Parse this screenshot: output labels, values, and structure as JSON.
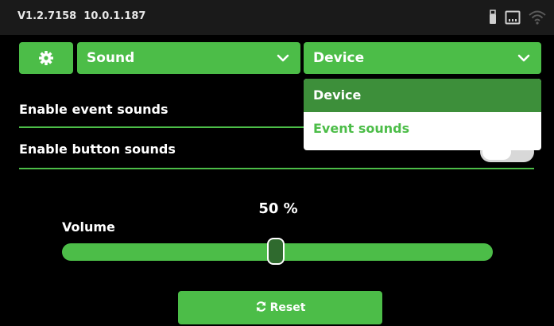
{
  "statusbar": {
    "version": "V1.2.7158",
    "ip": "10.0.1.187",
    "icons": [
      "usb-icon",
      "ethernet-icon",
      "wifi-icon"
    ]
  },
  "header": {
    "settings_icon": "gear-icon",
    "category_dropdown": {
      "selected": "Sound"
    },
    "section_dropdown": {
      "selected": "Device",
      "options": [
        "Device",
        "Event sounds"
      ]
    }
  },
  "settings": {
    "event_sounds": {
      "label": "Enable event sounds"
    },
    "button_sounds": {
      "label": "Enable button sounds",
      "enabled": false
    }
  },
  "volume": {
    "label": "Volume",
    "value_text": "50 %",
    "value": 50
  },
  "reset_button": {
    "label": "Reset",
    "icon": "refresh-icon"
  },
  "colors": {
    "accent": "#4cbd48",
    "accent_dark": "#3d8f3a",
    "background": "#000000",
    "statusbar": "#1a1a1a"
  }
}
